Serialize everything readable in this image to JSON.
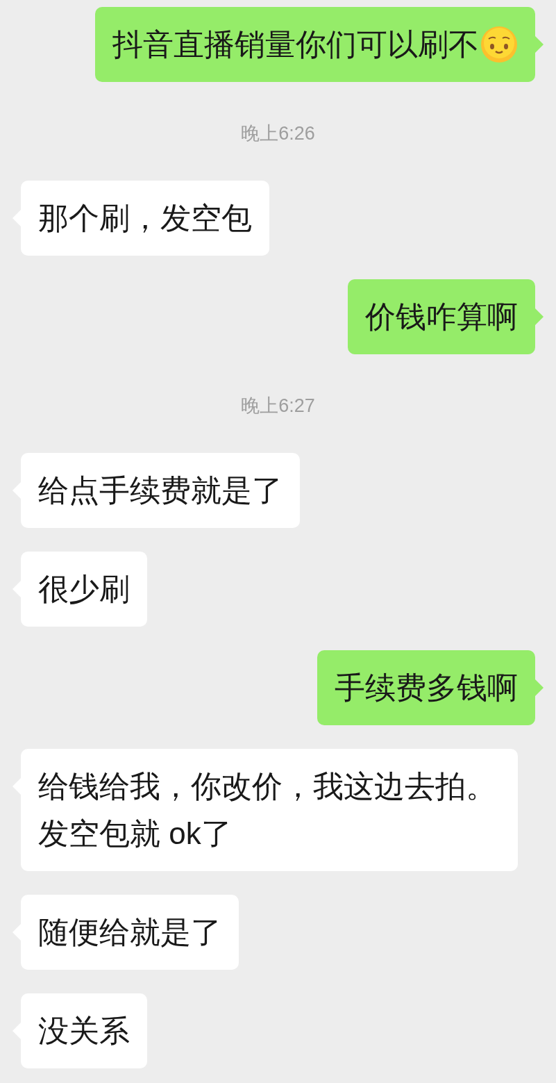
{
  "items": [
    {
      "kind": "message",
      "outgoing": true,
      "text": "抖音直播销量你们可以刷不",
      "emoji_after": true
    },
    {
      "kind": "time",
      "text": "晚上6:26"
    },
    {
      "kind": "message",
      "outgoing": false,
      "text": "那个刷，发空包"
    },
    {
      "kind": "message",
      "outgoing": true,
      "text": "价钱咋算啊"
    },
    {
      "kind": "time",
      "text": "晚上6:27"
    },
    {
      "kind": "message",
      "outgoing": false,
      "text": "给点手续费就是了"
    },
    {
      "kind": "message",
      "outgoing": false,
      "text": "很少刷"
    },
    {
      "kind": "message",
      "outgoing": true,
      "text": "手续费多钱啊"
    },
    {
      "kind": "message",
      "outgoing": false,
      "text": "给钱给我，你改价，我这边去拍。发空包就 ok了"
    },
    {
      "kind": "message",
      "outgoing": false,
      "text": "随便给就是了"
    },
    {
      "kind": "message",
      "outgoing": false,
      "text": "没关系"
    }
  ]
}
